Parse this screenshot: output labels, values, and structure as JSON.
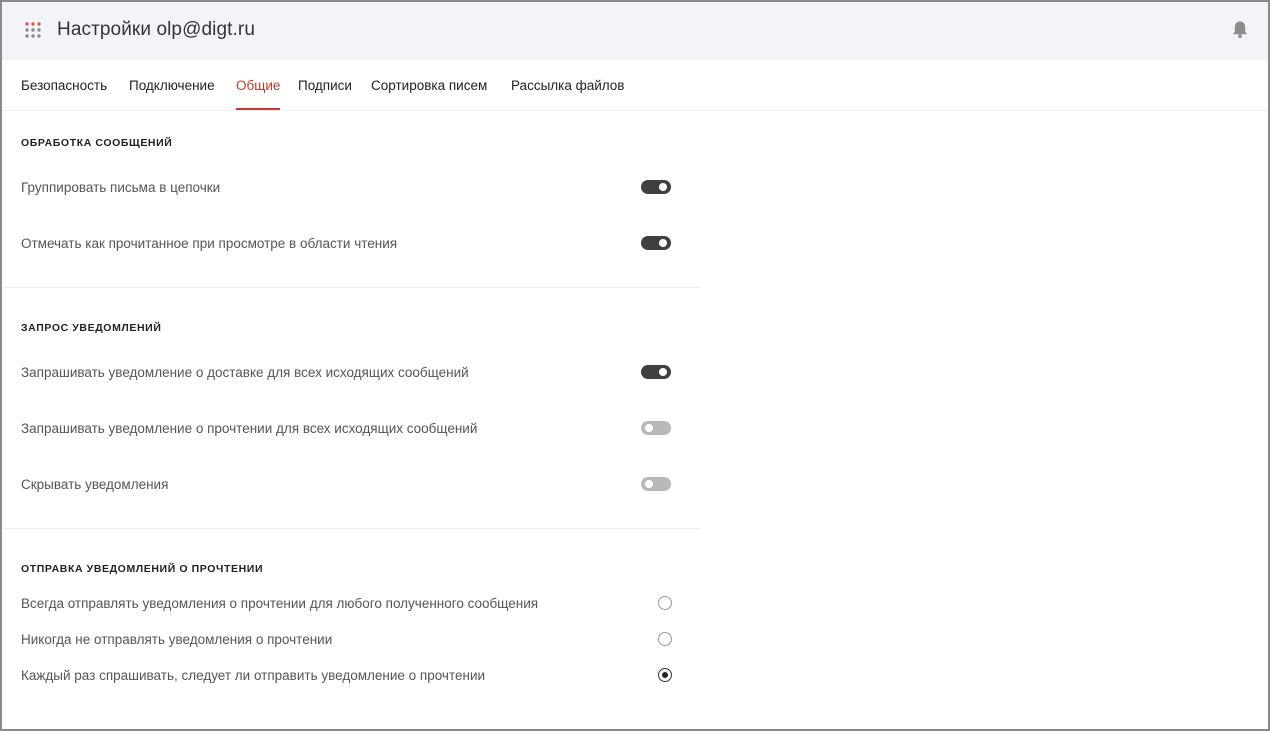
{
  "header": {
    "title": "Настройки olp@digt.ru",
    "apps_icon": "apps-grid-icon",
    "bell_icon": "bell-icon"
  },
  "tabs": [
    {
      "label": "Безопасность",
      "active": false
    },
    {
      "label": "Подключение",
      "active": false
    },
    {
      "label": "Общие",
      "active": true
    },
    {
      "label": "Подписи",
      "active": false
    },
    {
      "label": "Сортировка писем",
      "active": false
    },
    {
      "label": "Рассылка файлов",
      "active": false
    }
  ],
  "sections": {
    "processing": {
      "title": "ОБРАБОТКА СООБЩЕНИЙ",
      "items": [
        {
          "label": "Группировать письма в цепочки",
          "enabled": true
        },
        {
          "label": "Отмечать как прочитанное при просмотре в области чтения",
          "enabled": true
        }
      ]
    },
    "request": {
      "title": "ЗАПРОС УВЕДОМЛЕНИЙ",
      "items": [
        {
          "label": "Запрашивать уведомление о доставке для всех исходящих сообщений",
          "enabled": true
        },
        {
          "label": "Запрашивать уведомление о прочтении для всех исходящих сообщений",
          "enabled": false
        },
        {
          "label": "Скрывать уведомления",
          "enabled": false
        }
      ]
    },
    "send_read": {
      "title": "ОТПРАВКА УВЕДОМЛЕНИЙ О ПРОЧТЕНИИ",
      "options": [
        {
          "label": "Всегда отправлять уведомления о прочтении для любого полученного сообщения",
          "selected": false
        },
        {
          "label": "Никогда не отправлять уведомления о прочтении",
          "selected": false
        },
        {
          "label": "Каждый раз спрашивать, следует ли отправить уведомление о прочтении",
          "selected": true
        }
      ]
    }
  },
  "colors": {
    "accent": "#c0392b",
    "toggle_on": "#3f3f3f",
    "toggle_off": "#b9b9b9",
    "header_bg": "#f3f4f7"
  }
}
